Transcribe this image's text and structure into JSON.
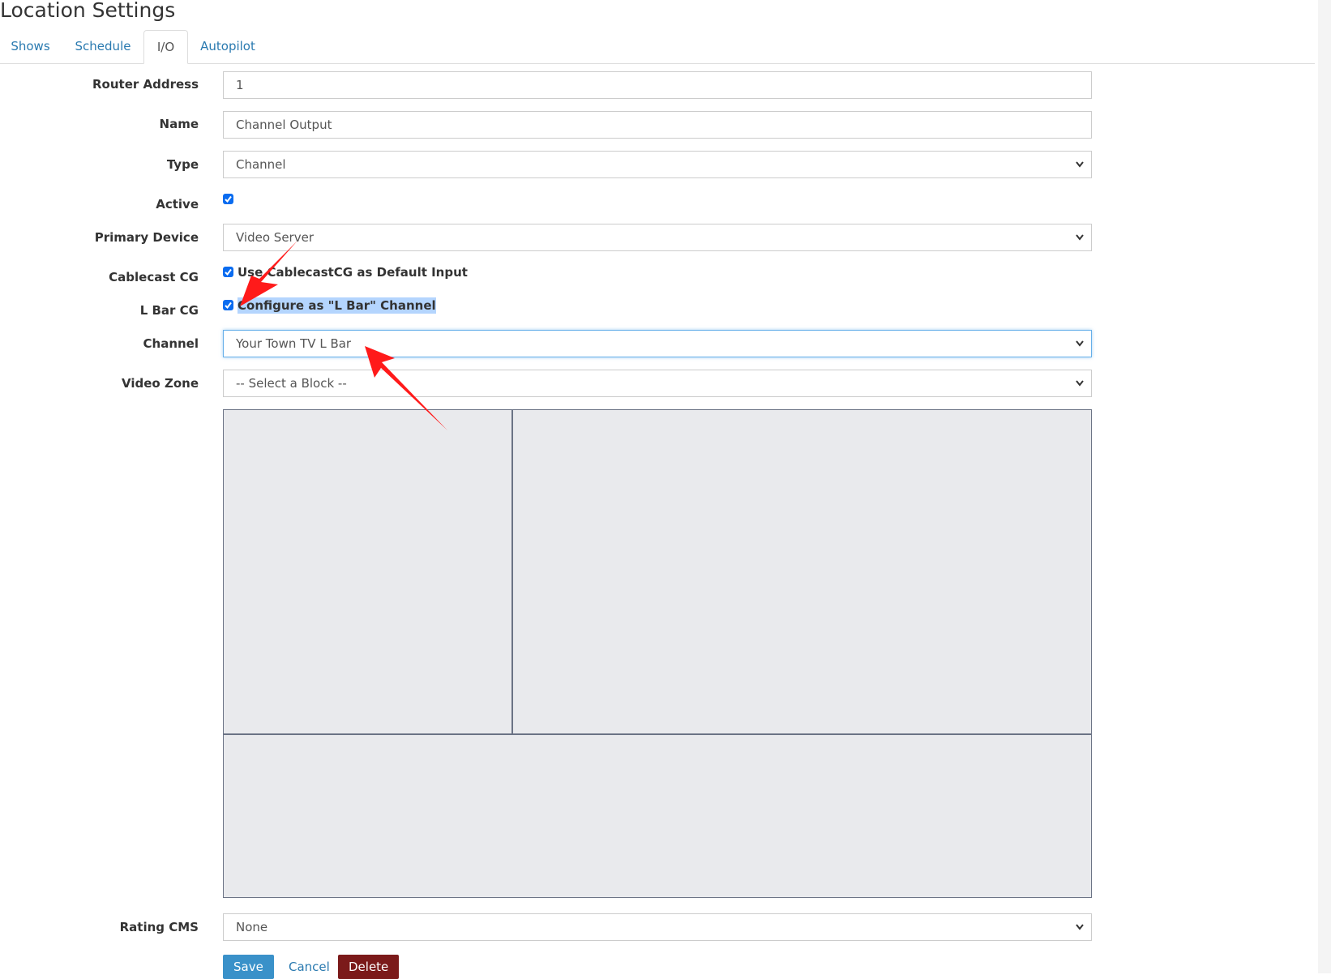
{
  "page": {
    "title": "Location Settings"
  },
  "tabs": [
    {
      "label": "Shows",
      "active": false
    },
    {
      "label": "Schedule",
      "active": false
    },
    {
      "label": "I/O",
      "active": true
    },
    {
      "label": "Autopilot",
      "active": false
    }
  ],
  "form": {
    "router_address": {
      "label": "Router Address",
      "value": "1"
    },
    "name": {
      "label": "Name",
      "value": "Channel Output"
    },
    "type": {
      "label": "Type",
      "value": "Channel"
    },
    "active": {
      "label": "Active",
      "checked": true
    },
    "primary_device": {
      "label": "Primary Device",
      "value": "Video Server"
    },
    "cablecast_cg": {
      "label": "Cablecast CG",
      "checked": true,
      "text": "Use CablecastCG as Default Input"
    },
    "lbar_cg": {
      "label": "L Bar CG",
      "checked": true,
      "text": "Configure as \"L Bar\" Channel"
    },
    "channel": {
      "label": "Channel",
      "value": "Your Town TV L Bar"
    },
    "video_zone": {
      "label": "Video Zone",
      "value": "-- Select a Block --"
    },
    "rating_cms": {
      "label": "Rating CMS",
      "value": "None"
    }
  },
  "buttons": {
    "save": "Save",
    "cancel": "Cancel",
    "delete": "Delete"
  },
  "icons": {
    "dropdown": "chevron-down-icon",
    "check": "check-icon",
    "annotation": "red-arrow-icon"
  },
  "colors": {
    "link": "#2a7ab0",
    "save": "#3a91c9",
    "delete": "#7b1a1a",
    "checkbox": "#0a6cf0",
    "annotation": "#ff0000"
  }
}
